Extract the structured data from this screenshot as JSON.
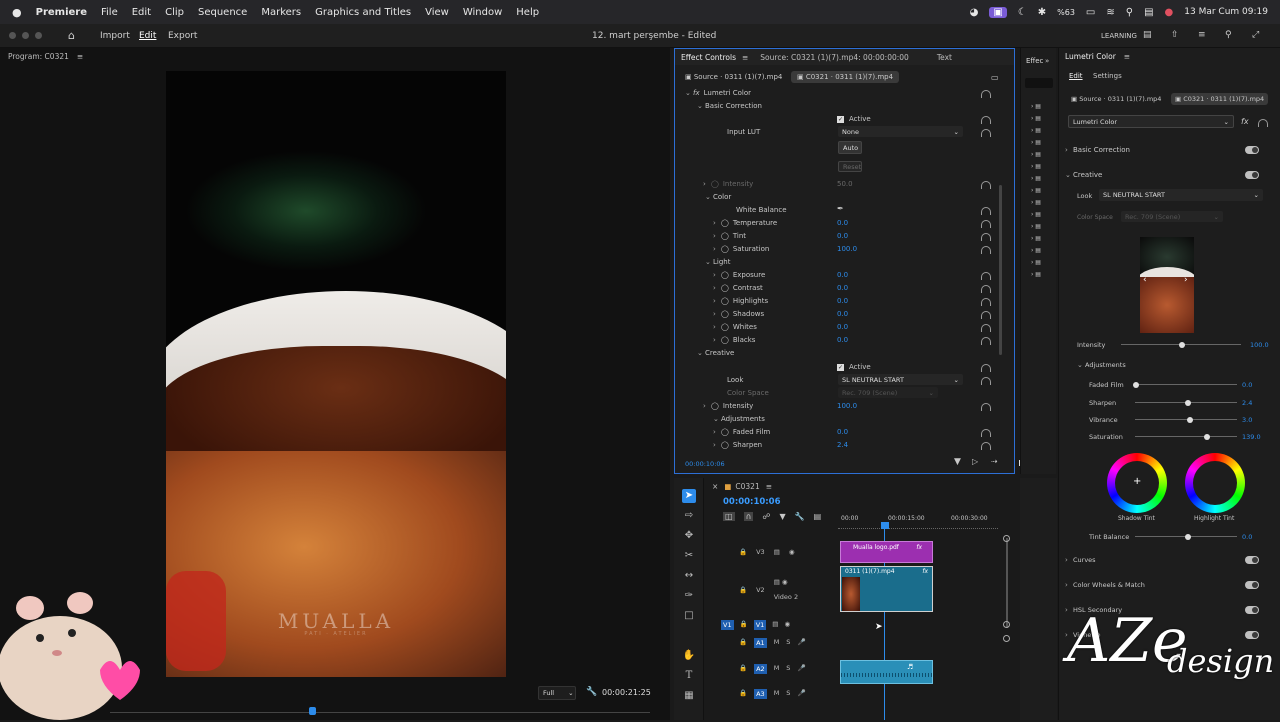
{
  "menubar": {
    "app": "Premiere",
    "items": [
      "File",
      "Edit",
      "Clip",
      "Sequence",
      "Markers",
      "Graphics and Titles",
      "View",
      "Window",
      "Help"
    ],
    "battery": "%63",
    "datetime": "13 Mar Cum 09:19"
  },
  "toolbar": {
    "import": "Import",
    "edit": "Edit",
    "export": "Export",
    "project_title": "12. mart perşembe - Edited",
    "workspace": "LEARNING"
  },
  "program": {
    "title": "Program: C0321",
    "watermark": "MUALLA",
    "watermark_sub": "PATI · ATELIER",
    "fit": "Full",
    "timecode": "00:00:21:25"
  },
  "effect_controls": {
    "tab_label": "Effect Controls",
    "source_label": "Source: C0321 (1)(7).mp4: 00:00:00:00",
    "text_tab": "Text",
    "clip_src": "Source · 0311 (1)(7).mp4",
    "clip_seq": "C0321 · 0311 (1)(7).mp4",
    "effect": "Lumetri Color",
    "basic": "Basic Correction",
    "active": "Active",
    "input_lut": "Input LUT",
    "input_lut_val": "None",
    "auto": "Auto",
    "reset": "Reset",
    "intensity": "Intensity",
    "intensity_val": "50.0",
    "color": "Color",
    "white_balance": "White Balance",
    "temperature": "Temperature",
    "temperature_val": "0.0",
    "tint": "Tint",
    "tint_val": "0.0",
    "saturation": "Saturation",
    "saturation_val": "100.0",
    "light": "Light",
    "exposure": "Exposure",
    "exposure_val": "0.0",
    "contrast": "Contrast",
    "contrast_val": "0.0",
    "highlights": "Highlights",
    "highlights_val": "0.0",
    "shadows": "Shadows",
    "shadows_val": "0.0",
    "whites": "Whites",
    "whites_val": "0.0",
    "blacks": "Blacks",
    "blacks_val": "0.0",
    "creative": "Creative",
    "creative_active": "Active",
    "look": "Look",
    "look_val": "SL NEUTRAL START",
    "color_space": "Color Space",
    "color_space_val": "Rec. 709 (Scene)",
    "c_intensity": "Intensity",
    "c_intensity_val": "100.0",
    "adjustments": "Adjustments",
    "faded_film": "Faded Film",
    "faded_film_val": "0.0",
    "sharpen": "Sharpen",
    "sharpen_val": "2.4",
    "timecode": "00:00:10:06"
  },
  "effects_strip": {
    "label": "Effec"
  },
  "lumetri": {
    "title": "Lumetri Color",
    "edit_tab": "Edit",
    "settings_tab": "Settings",
    "src": "Source · 0311 (1)(7).mp4",
    "seq": "C0321 · 0311 (1)(7).mp4",
    "effect_select": "Lumetri Color",
    "basic": "Basic Correction",
    "creative": "Creative",
    "look": "Look",
    "look_val": "SL NEUTRAL START",
    "color_space": "Color Space",
    "color_space_val": "Rec. 709 (Scene)",
    "intensity": "Intensity",
    "intensity_val": "100.0",
    "adjustments": "Adjustments",
    "faded_film": "Faded Film",
    "faded_film_val": "0.0",
    "sharpen": "Sharpen",
    "sharpen_val": "2.4",
    "vibrance": "Vibrance",
    "vibrance_val": "3.0",
    "saturation": "Saturation",
    "saturation_val": "139.0",
    "shadow_tint": "Shadow Tint",
    "highlight_tint": "Highlight Tint",
    "tint_balance": "Tint Balance",
    "tint_balance_val": "0.0",
    "curves": "Curves",
    "wheels": "Color Wheels & Match",
    "hsl": "HSL Secondary",
    "vignette": "Vignette",
    "overlay_big": "AZe",
    "overlay_script": "design"
  },
  "timeline": {
    "seq": "C0321",
    "timecode": "00:00:10:06",
    "ruler": [
      "00:00",
      "00:00:15:00",
      "00:00:30:00"
    ],
    "tracks": [
      "V3",
      "V2",
      "V1",
      "A1",
      "A2",
      "A3"
    ],
    "track_name_v2": "Video 2",
    "clip_v3": "Mualla logo.pdf",
    "clip_v2": "0311 (1)(7).mp4",
    "fx": "fx"
  }
}
